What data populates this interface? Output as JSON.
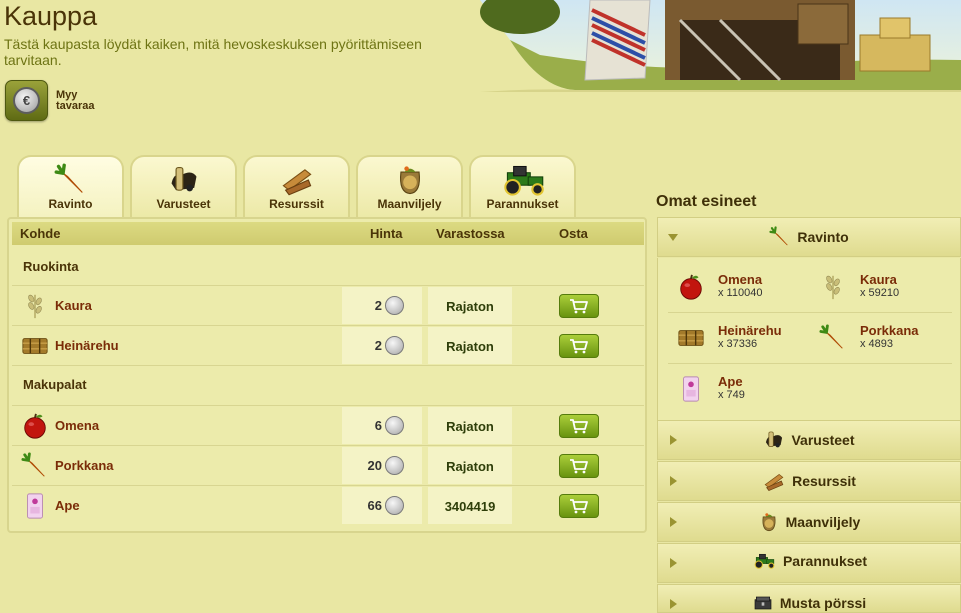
{
  "header": {
    "title": "Kauppa",
    "description": "Tästä kaupasta löydät kaiken, mitä hevoskeskuksen pyörittämiseen tarvitaan.",
    "sell_label": "Myy tavaraa"
  },
  "tabs": [
    {
      "label": "Ravinto",
      "icon": "carrot-icon",
      "active": true
    },
    {
      "label": "Varusteet",
      "icon": "saddle-icon",
      "active": false
    },
    {
      "label": "Resurssit",
      "icon": "wood-icon",
      "active": false
    },
    {
      "label": "Maanviljely",
      "icon": "seed-bag-icon",
      "active": false
    },
    {
      "label": "Parannukset",
      "icon": "tractor-icon",
      "active": false
    }
  ],
  "table": {
    "columns": {
      "item": "Kohde",
      "price": "Hinta",
      "stock": "Varastossa",
      "buy": "Osta"
    },
    "sections": [
      {
        "title": "Ruokinta",
        "rows": [
          {
            "name": "Kaura",
            "price": "2",
            "stock": "Rajaton",
            "icon": "oat-icon"
          },
          {
            "name": "Heinärehu",
            "price": "2",
            "stock": "Rajaton",
            "icon": "hay-bale-icon"
          }
        ]
      },
      {
        "title": "Makupalat",
        "rows": [
          {
            "name": "Omena",
            "price": "6",
            "stock": "Rajaton",
            "icon": "apple-icon"
          },
          {
            "name": "Porkkana",
            "price": "20",
            "stock": "Rajaton",
            "icon": "carrot-icon"
          },
          {
            "name": "Ape",
            "price": "66",
            "stock": "3404419",
            "icon": "feed-bag-icon"
          }
        ]
      }
    ]
  },
  "inventory": {
    "title": "Omat esineet",
    "categories": [
      {
        "label": "Ravinto",
        "open": true,
        "icon": "carrot-icon"
      },
      {
        "label": "Varusteet",
        "open": false,
        "icon": "saddle-icon"
      },
      {
        "label": "Resurssit",
        "open": false,
        "icon": "wood-icon"
      },
      {
        "label": "Maanviljely",
        "open": false,
        "icon": "seed-bag-icon"
      },
      {
        "label": "Parannukset",
        "open": false,
        "icon": "tractor-icon"
      },
      {
        "label": "Musta pörssi",
        "open": false,
        "icon": "chest-icon"
      }
    ],
    "items": [
      {
        "name": "Omena",
        "count": "x 110040",
        "icon": "apple-icon"
      },
      {
        "name": "Kaura",
        "count": "x 59210",
        "icon": "oat-icon"
      },
      {
        "name": "Heinärehu",
        "count": "x 37336",
        "icon": "hay-bale-icon"
      },
      {
        "name": "Porkkana",
        "count": "x 4893",
        "icon": "carrot-icon"
      },
      {
        "name": "Ape",
        "count": "x 749",
        "icon": "feed-bag-icon"
      }
    ]
  },
  "colors": {
    "accent_green": "#7aa31a",
    "item_name": "#7a2c08",
    "panel_bg": "#ecebab"
  }
}
